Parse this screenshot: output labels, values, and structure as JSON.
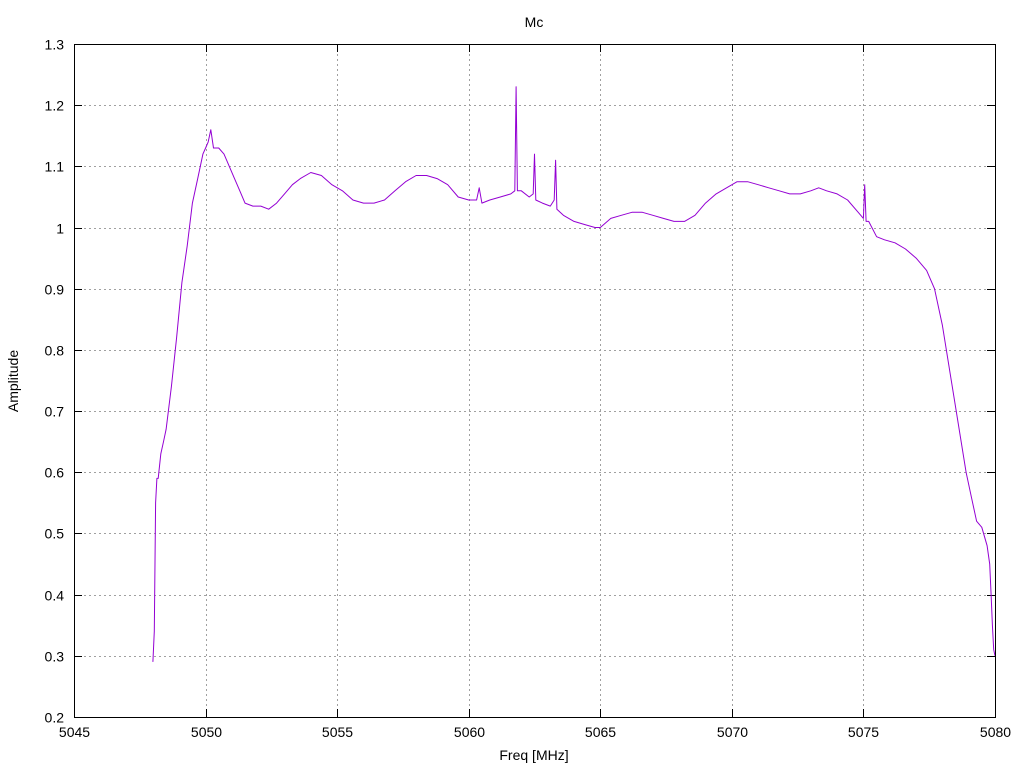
{
  "chart_data": {
    "type": "line",
    "title": "Mc",
    "xlabel": "Freq [MHz]",
    "ylabel": "Amplitude",
    "xlim": [
      5045,
      5080
    ],
    "ylim": [
      0.2,
      1.3
    ],
    "grid": true,
    "xticks": [
      "5045",
      "5050",
      "5055",
      "5060",
      "5065",
      "5070",
      "5075",
      "5080"
    ],
    "yticks": [
      "0.2",
      "0.3",
      "0.4",
      "0.5",
      "0.6",
      "0.7",
      "0.8",
      "0.9",
      "1",
      "1.1",
      "1.2",
      "1.3"
    ],
    "series": [
      {
        "color": "#9400d3",
        "x": [
          5048.0,
          5048.05,
          5048.1,
          5048.15,
          5048.2,
          5048.3,
          5048.4,
          5048.5,
          5048.7,
          5048.9,
          5049.1,
          5049.3,
          5049.5,
          5049.7,
          5049.9,
          5050.0,
          5050.1,
          5050.2,
          5050.3,
          5050.5,
          5050.7,
          5050.9,
          5051.1,
          5051.3,
          5051.5,
          5051.8,
          5052.1,
          5052.4,
          5052.7,
          5053.0,
          5053.3,
          5053.6,
          5054.0,
          5054.4,
          5054.8,
          5055.2,
          5055.6,
          5056.0,
          5056.4,
          5056.8,
          5057.2,
          5057.6,
          5058.0,
          5058.4,
          5058.8,
          5059.2,
          5059.6,
          5060.0,
          5060.3,
          5060.4,
          5060.5,
          5060.8,
          5061.2,
          5061.6,
          5061.75,
          5061.8,
          5061.85,
          5062.0,
          5062.3,
          5062.45,
          5062.5,
          5062.55,
          5062.8,
          5063.1,
          5063.25,
          5063.3,
          5063.35,
          5063.6,
          5064.0,
          5064.4,
          5064.8,
          5065.0,
          5065.4,
          5065.8,
          5066.2,
          5066.6,
          5067.0,
          5067.4,
          5067.8,
          5068.2,
          5068.6,
          5069.0,
          5069.4,
          5069.8,
          5070.2,
          5070.6,
          5071.0,
          5071.4,
          5071.8,
          5072.2,
          5072.6,
          5073.0,
          5073.3,
          5073.6,
          5074.0,
          5074.4,
          5074.8,
          5075.0,
          5075.05,
          5075.1,
          5075.2,
          5075.5,
          5075.8,
          5076.2,
          5076.6,
          5077.0,
          5077.4,
          5077.7,
          5078.0,
          5078.3,
          5078.6,
          5078.9,
          5079.1,
          5079.3,
          5079.5,
          5079.7,
          5079.8,
          5079.85,
          5079.9,
          5079.95,
          5080.0
        ],
        "y": [
          0.29,
          0.34,
          0.55,
          0.59,
          0.59,
          0.63,
          0.65,
          0.67,
          0.74,
          0.82,
          0.91,
          0.97,
          1.04,
          1.08,
          1.12,
          1.13,
          1.14,
          1.16,
          1.13,
          1.13,
          1.12,
          1.1,
          1.08,
          1.06,
          1.04,
          1.035,
          1.035,
          1.03,
          1.04,
          1.055,
          1.07,
          1.08,
          1.09,
          1.085,
          1.07,
          1.06,
          1.045,
          1.04,
          1.04,
          1.045,
          1.06,
          1.075,
          1.085,
          1.085,
          1.08,
          1.07,
          1.05,
          1.045,
          1.045,
          1.065,
          1.04,
          1.045,
          1.05,
          1.055,
          1.06,
          1.23,
          1.06,
          1.06,
          1.05,
          1.055,
          1.12,
          1.045,
          1.04,
          1.035,
          1.045,
          1.11,
          1.03,
          1.02,
          1.01,
          1.005,
          1.0,
          1.0,
          1.015,
          1.02,
          1.025,
          1.025,
          1.02,
          1.015,
          1.01,
          1.01,
          1.02,
          1.04,
          1.055,
          1.065,
          1.075,
          1.075,
          1.07,
          1.065,
          1.06,
          1.055,
          1.055,
          1.06,
          1.065,
          1.06,
          1.055,
          1.045,
          1.025,
          1.015,
          1.07,
          1.01,
          1.01,
          0.985,
          0.98,
          0.975,
          0.965,
          0.95,
          0.93,
          0.9,
          0.84,
          0.76,
          0.68,
          0.6,
          0.56,
          0.52,
          0.51,
          0.48,
          0.45,
          0.4,
          0.35,
          0.31,
          0.3
        ]
      }
    ]
  }
}
